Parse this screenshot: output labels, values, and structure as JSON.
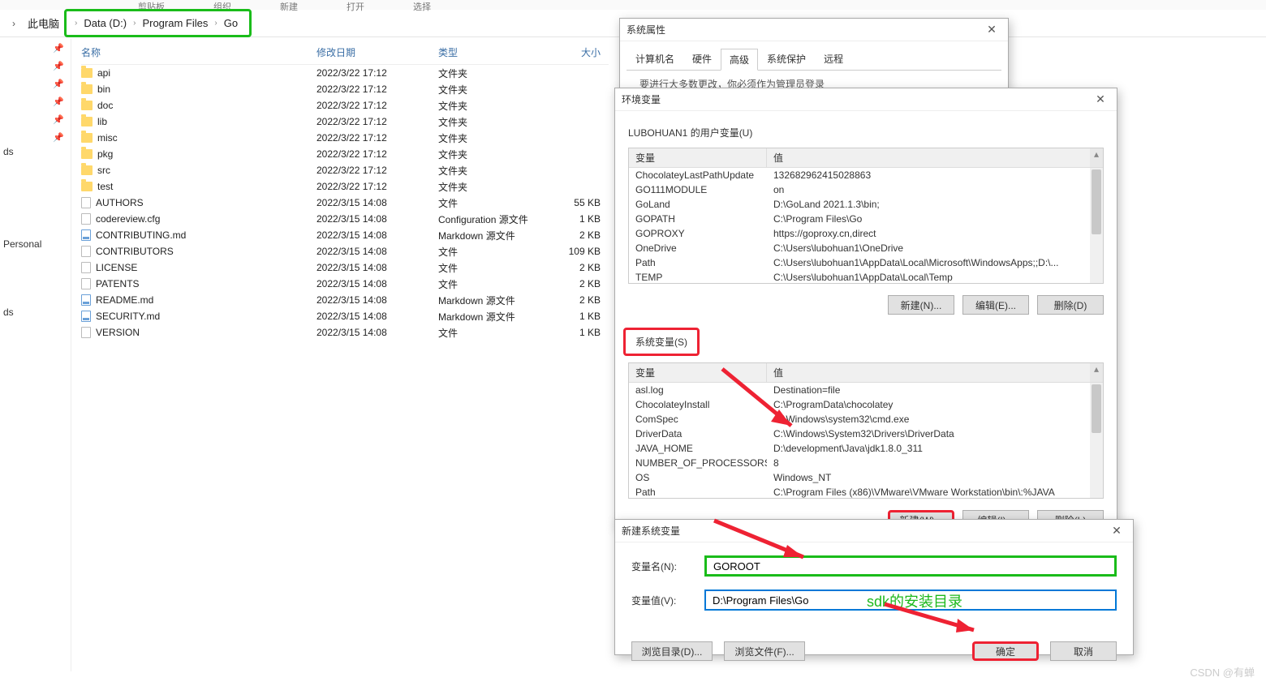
{
  "ribbon": [
    "剪贴板",
    "组织",
    "新建",
    "打开",
    "选择"
  ],
  "breadcrumb": {
    "root_arrow": "›",
    "items": [
      "此电脑",
      "Data (D:)",
      "Program Files",
      "Go"
    ]
  },
  "sidebar": {
    "labels": [
      "ds",
      "Personal",
      "ds"
    ]
  },
  "filelist": {
    "headers": {
      "name": "名称",
      "date": "修改日期",
      "type": "类型",
      "size": "大小"
    },
    "rows": [
      {
        "icon": "folder",
        "name": "api",
        "date": "2022/3/22 17:12",
        "type": "文件夹",
        "size": ""
      },
      {
        "icon": "folder",
        "name": "bin",
        "date": "2022/3/22 17:12",
        "type": "文件夹",
        "size": ""
      },
      {
        "icon": "folder",
        "name": "doc",
        "date": "2022/3/22 17:12",
        "type": "文件夹",
        "size": ""
      },
      {
        "icon": "folder",
        "name": "lib",
        "date": "2022/3/22 17:12",
        "type": "文件夹",
        "size": ""
      },
      {
        "icon": "folder",
        "name": "misc",
        "date": "2022/3/22 17:12",
        "type": "文件夹",
        "size": ""
      },
      {
        "icon": "folder",
        "name": "pkg",
        "date": "2022/3/22 17:12",
        "type": "文件夹",
        "size": ""
      },
      {
        "icon": "folder",
        "name": "src",
        "date": "2022/3/22 17:12",
        "type": "文件夹",
        "size": ""
      },
      {
        "icon": "folder",
        "name": "test",
        "date": "2022/3/22 17:12",
        "type": "文件夹",
        "size": ""
      },
      {
        "icon": "file",
        "name": "AUTHORS",
        "date": "2022/3/15 14:08",
        "type": "文件",
        "size": "55 KB"
      },
      {
        "icon": "file",
        "name": "codereview.cfg",
        "date": "2022/3/15 14:08",
        "type": "Configuration 源文件",
        "size": "1 KB"
      },
      {
        "icon": "md",
        "name": "CONTRIBUTING.md",
        "date": "2022/3/15 14:08",
        "type": "Markdown 源文件",
        "size": "2 KB"
      },
      {
        "icon": "file",
        "name": "CONTRIBUTORS",
        "date": "2022/3/15 14:08",
        "type": "文件",
        "size": "109 KB"
      },
      {
        "icon": "file",
        "name": "LICENSE",
        "date": "2022/3/15 14:08",
        "type": "文件",
        "size": "2 KB"
      },
      {
        "icon": "file",
        "name": "PATENTS",
        "date": "2022/3/15 14:08",
        "type": "文件",
        "size": "2 KB"
      },
      {
        "icon": "md",
        "name": "README.md",
        "date": "2022/3/15 14:08",
        "type": "Markdown 源文件",
        "size": "2 KB"
      },
      {
        "icon": "md",
        "name": "SECURITY.md",
        "date": "2022/3/15 14:08",
        "type": "Markdown 源文件",
        "size": "1 KB"
      },
      {
        "icon": "file",
        "name": "VERSION",
        "date": "2022/3/15 14:08",
        "type": "文件",
        "size": "1 KB"
      }
    ]
  },
  "sysprops": {
    "title": "系统属性",
    "tabs": [
      "计算机名",
      "硬件",
      "高级",
      "系统保护",
      "远程"
    ],
    "active_tab": 2,
    "note": "要进行大多数更改，你必须作为管理员登录"
  },
  "envvar": {
    "title": "环境变量",
    "user_section": "LUBOHUAN1 的用户变量(U)",
    "headers": {
      "var": "变量",
      "val": "值"
    },
    "user_rows": [
      {
        "var": "ChocolateyLastPathUpdate",
        "val": "132682962415028863"
      },
      {
        "var": "GO111MODULE",
        "val": "on"
      },
      {
        "var": "GoLand",
        "val": "D:\\GoLand 2021.1.3\\bin;"
      },
      {
        "var": "GOPATH",
        "val": "C:\\Program Files\\Go"
      },
      {
        "var": "GOPROXY",
        "val": "https://goproxy.cn,direct"
      },
      {
        "var": "OneDrive",
        "val": "C:\\Users\\lubohuan1\\OneDrive"
      },
      {
        "var": "Path",
        "val": "C:\\Users\\lubohuan1\\AppData\\Local\\Microsoft\\WindowsApps;;D:\\..."
      },
      {
        "var": "TEMP",
        "val": "C:\\Users\\lubohuan1\\AppData\\Local\\Temp"
      }
    ],
    "sys_section": "系统变量(S)",
    "sys_rows": [
      {
        "var": "asl.log",
        "val": "Destination=file"
      },
      {
        "var": "ChocolateyInstall",
        "val": "C:\\ProgramData\\chocolatey"
      },
      {
        "var": "ComSpec",
        "val": "C:\\Windows\\system32\\cmd.exe"
      },
      {
        "var": "DriverData",
        "val": "C:\\Windows\\System32\\Drivers\\DriverData"
      },
      {
        "var": "JAVA_HOME",
        "val": "D:\\development\\Java\\jdk1.8.0_311"
      },
      {
        "var": "NUMBER_OF_PROCESSORS",
        "val": "8"
      },
      {
        "var": "OS",
        "val": "Windows_NT"
      },
      {
        "var": "Path",
        "val": "C:\\Program Files (x86)\\VMware\\VMware Workstation\\bin\\:%JAVA"
      }
    ],
    "buttons_user": {
      "new": "新建(N)...",
      "edit": "编辑(E)...",
      "del": "删除(D)"
    },
    "buttons_sys": {
      "new": "新建(W)...",
      "edit": "编辑(I)...",
      "del": "删除(L)"
    }
  },
  "newvar": {
    "title": "新建系统变量",
    "name_label": "变量名(N):",
    "name_value": "GOROOT",
    "value_label": "变量值(V):",
    "value_value": "D:\\Program Files\\Go",
    "browse_dir": "浏览目录(D)...",
    "browse_file": "浏览文件(F)...",
    "ok": "确定",
    "cancel": "取消",
    "annotation": "sdk的安装目录"
  },
  "watermark": "CSDN @有蝉"
}
